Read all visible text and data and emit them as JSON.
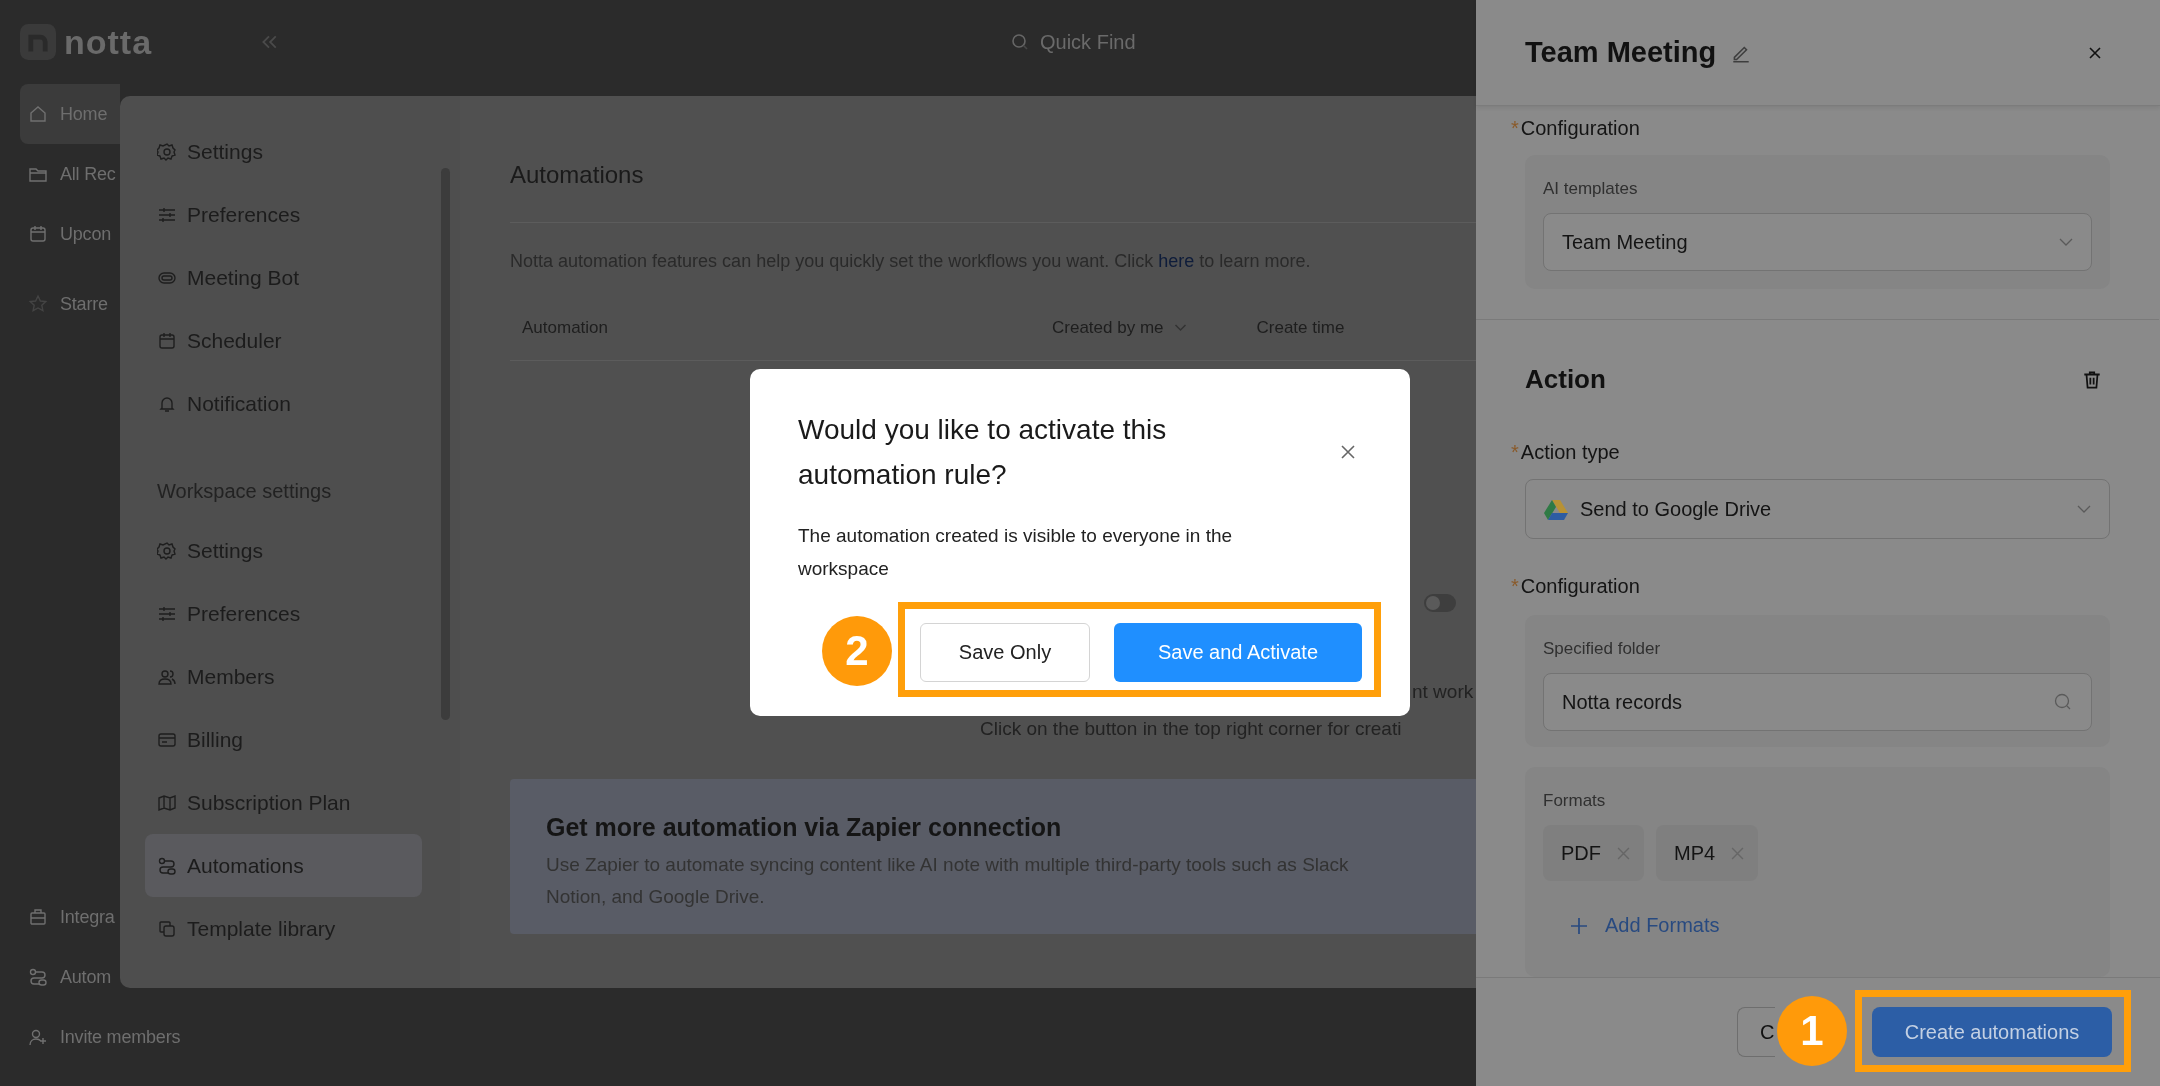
{
  "app": {
    "logo": "notta",
    "search": {
      "placeholder": "Quick Find"
    },
    "nav": [
      {
        "label": "Home",
        "selected": true
      },
      {
        "label": "All Rec",
        "selected": false
      },
      {
        "label": "Upcon",
        "selected": false
      }
    ],
    "starred": "Starre",
    "nav_bottom": [
      "Integra",
      "Autom",
      "Invite members"
    ]
  },
  "settings": {
    "personal_items": [
      {
        "label": "Settings",
        "selected": false
      },
      {
        "label": "Preferences",
        "selected": false
      },
      {
        "label": "Meeting Bot",
        "selected": false
      },
      {
        "label": "Scheduler",
        "selected": false
      },
      {
        "label": "Notification",
        "selected": false
      }
    ],
    "workspace_heading": "Workspace settings",
    "workspace_items": [
      {
        "label": "Settings",
        "selected": false
      },
      {
        "label": "Preferences",
        "selected": false
      },
      {
        "label": "Members",
        "selected": false
      },
      {
        "label": "Billing",
        "selected": false
      },
      {
        "label": "Subscription Plan",
        "selected": false
      },
      {
        "label": "Automations",
        "selected": true
      },
      {
        "label": "Template library",
        "selected": false
      }
    ]
  },
  "page": {
    "title": "Automations",
    "description_before": "Notta automation features can help you quickly set the workflows you want. Click ",
    "link": "here",
    "description_after": " to learn more.",
    "columns": [
      "Automation",
      "Created by me",
      "Create time"
    ],
    "toggle": {
      "on": false
    },
    "empty_lines": [
      "nt work",
      "Click on the button in the top right corner for creati"
    ],
    "zapier": {
      "title": "Get more automation via Zapier connection",
      "lines": [
        "Use Zapier to automate syncing content like AI note with multiple third-party tools such as Slack",
        "Notion, and Google Drive."
      ]
    }
  },
  "modal": {
    "title": "Would you like to activate this automation rule?",
    "body": "The automation created is visible to everyone in the workspace",
    "buttons": [
      {
        "label": "Save Only",
        "kind": "secondary"
      },
      {
        "label": "Save and Activate",
        "kind": "primary"
      }
    ]
  },
  "drawer": {
    "title": "Team Meeting",
    "trigger": {
      "label": "Configuration",
      "mark": "*",
      "field_label": "AI templates",
      "value": "Team Meeting"
    },
    "action": {
      "title": "Action",
      "type_label": "Action type",
      "type_mark": "*",
      "type_value": "Send to Google Drive",
      "config_label": "Configuration",
      "config_mark": "*",
      "folder_label": "Specified folder",
      "folder_value": "Notta records",
      "formats_label": "Formats",
      "formats": [
        "PDF",
        "MP4"
      ],
      "add": "Add Formats"
    },
    "footer": {
      "cancel": "C",
      "create": "Create automations"
    }
  },
  "annotations": [
    {
      "label": "1"
    },
    {
      "label": "2"
    }
  ]
}
